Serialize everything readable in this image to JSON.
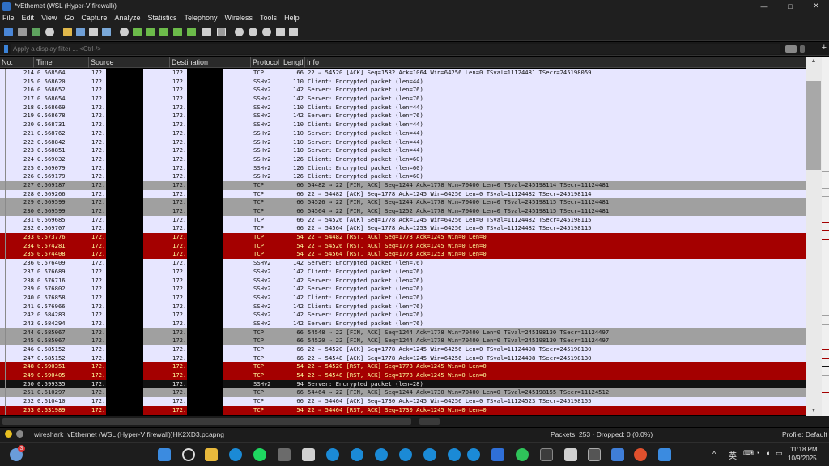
{
  "window": {
    "title": "*vEthernet (WSL (Hyper-V firewall))"
  },
  "menu": [
    "File",
    "Edit",
    "View",
    "Go",
    "Capture",
    "Analyze",
    "Statistics",
    "Telephony",
    "Wireless",
    "Tools",
    "Help"
  ],
  "filter": {
    "placeholder": "Apply a display filter ... <Ctrl-/>"
  },
  "columns": {
    "no": "No.",
    "time": "Time",
    "source": "Source",
    "destination": "Destination",
    "protocol": "Protocol",
    "length": "Lengtl",
    "info": "Info"
  },
  "packets": [
    {
      "no": "214",
      "time": "0.568564",
      "src": "172.",
      "dst": "172.",
      "proto": "TCP",
      "len": "66",
      "info": "22 → 54520 [ACK] Seq=1582 Ack=1064 Win=64256 Len=0 TSval=11124481 TSecr=245198059",
      "style": "tcp"
    },
    {
      "no": "215",
      "time": "0.568620",
      "src": "172.",
      "dst": "172.",
      "proto": "SSHv2",
      "len": "110",
      "info": "Client: Encrypted packet (len=44)",
      "style": "ssh"
    },
    {
      "no": "216",
      "time": "0.568652",
      "src": "172.",
      "dst": "172.",
      "proto": "SSHv2",
      "len": "142",
      "info": "Server: Encrypted packet (len=76)",
      "style": "ssh"
    },
    {
      "no": "217",
      "time": "0.568654",
      "src": "172.",
      "dst": "172.",
      "proto": "SSHv2",
      "len": "142",
      "info": "Server: Encrypted packet (len=76)",
      "style": "ssh"
    },
    {
      "no": "218",
      "time": "0.568669",
      "src": "172.",
      "dst": "172.",
      "proto": "SSHv2",
      "len": "110",
      "info": "Client: Encrypted packet (len=44)",
      "style": "ssh"
    },
    {
      "no": "219",
      "time": "0.568678",
      "src": "172.",
      "dst": "172.",
      "proto": "SSHv2",
      "len": "142",
      "info": "Server: Encrypted packet (len=76)",
      "style": "ssh"
    },
    {
      "no": "220",
      "time": "0.568731",
      "src": "172.",
      "dst": "172.",
      "proto": "SSHv2",
      "len": "110",
      "info": "Client: Encrypted packet (len=44)",
      "style": "ssh"
    },
    {
      "no": "221",
      "time": "0.568762",
      "src": "172.",
      "dst": "172.",
      "proto": "SSHv2",
      "len": "110",
      "info": "Server: Encrypted packet (len=44)",
      "style": "ssh"
    },
    {
      "no": "222",
      "time": "0.568842",
      "src": "172.",
      "dst": "172.",
      "proto": "SSHv2",
      "len": "110",
      "info": "Server: Encrypted packet (len=44)",
      "style": "ssh"
    },
    {
      "no": "223",
      "time": "0.568851",
      "src": "172.",
      "dst": "172.",
      "proto": "SSHv2",
      "len": "110",
      "info": "Server: Encrypted packet (len=44)",
      "style": "ssh"
    },
    {
      "no": "224",
      "time": "0.569032",
      "src": "172.",
      "dst": "172.",
      "proto": "SSHv2",
      "len": "126",
      "info": "Client: Encrypted packet (len=60)",
      "style": "ssh"
    },
    {
      "no": "225",
      "time": "0.569079",
      "src": "172.",
      "dst": "172.",
      "proto": "SSHv2",
      "len": "126",
      "info": "Client: Encrypted packet (len=60)",
      "style": "ssh"
    },
    {
      "no": "226",
      "time": "0.569179",
      "src": "172.",
      "dst": "172.",
      "proto": "SSHv2",
      "len": "126",
      "info": "Client: Encrypted packet (len=60)",
      "style": "ssh"
    },
    {
      "no": "227",
      "time": "0.569187",
      "src": "172.",
      "dst": "172.",
      "proto": "TCP",
      "len": "66",
      "info": "54482 → 22 [FIN, ACK] Seq=1244 Ack=1778 Win=70400 Len=0 TSval=245198114 TSecr=11124481",
      "style": "fin"
    },
    {
      "no": "228",
      "time": "0.569266",
      "src": "172.",
      "dst": "172.",
      "proto": "TCP",
      "len": "66",
      "info": "22 → 54482 [ACK] Seq=1778 Ack=1245 Win=64256 Len=0 TSval=11124482 TSecr=245198114",
      "style": "tcp"
    },
    {
      "no": "229",
      "time": "0.569599",
      "src": "172.",
      "dst": "172.",
      "proto": "TCP",
      "len": "66",
      "info": "54526 → 22 [FIN, ACK] Seq=1244 Ack=1778 Win=70400 Len=0 TSval=245198115 TSecr=11124481",
      "style": "fin"
    },
    {
      "no": "230",
      "time": "0.569599",
      "src": "172.",
      "dst": "172.",
      "proto": "TCP",
      "len": "66",
      "info": "54564 → 22 [FIN, ACK] Seq=1252 Ack=1778 Win=70400 Len=0 TSval=245198115 TSecr=11124481",
      "style": "fin"
    },
    {
      "no": "231",
      "time": "0.569685",
      "src": "172.",
      "dst": "172.",
      "proto": "TCP",
      "len": "66",
      "info": "22 → 54526 [ACK] Seq=1778 Ack=1245 Win=64256 Len=0 TSval=11124482 TSecr=245198115",
      "style": "tcp"
    },
    {
      "no": "232",
      "time": "0.569707",
      "src": "172.",
      "dst": "172.",
      "proto": "TCP",
      "len": "66",
      "info": "22 → 54564 [ACK] Seq=1778 Ack=1253 Win=64256 Len=0 TSval=11124482 TSecr=245198115",
      "style": "tcp"
    },
    {
      "no": "233",
      "time": "0.573776",
      "src": "172.",
      "dst": "172.",
      "proto": "TCP",
      "len": "54",
      "info": "22 → 54482 [RST, ACK] Seq=1778 Ack=1245 Win=0 Len=0",
      "style": "rst"
    },
    {
      "no": "234",
      "time": "0.574281",
      "src": "172.",
      "dst": "172.",
      "proto": "TCP",
      "len": "54",
      "info": "22 → 54526 [RST, ACK] Seq=1778 Ack=1245 Win=0 Len=0",
      "style": "rst"
    },
    {
      "no": "235",
      "time": "0.574408",
      "src": "172.",
      "dst": "172.",
      "proto": "TCP",
      "len": "54",
      "info": "22 → 54564 [RST, ACK] Seq=1778 Ack=1253 Win=0 Len=0",
      "style": "rst"
    },
    {
      "no": "236",
      "time": "0.576409",
      "src": "172.",
      "dst": "172.",
      "proto": "SSHv2",
      "len": "142",
      "info": "Server: Encrypted packet (len=76)",
      "style": "ssh"
    },
    {
      "no": "237",
      "time": "0.576689",
      "src": "172.",
      "dst": "172.",
      "proto": "SSHv2",
      "len": "142",
      "info": "Client: Encrypted packet (len=76)",
      "style": "ssh"
    },
    {
      "no": "238",
      "time": "0.576716",
      "src": "172.",
      "dst": "172.",
      "proto": "SSHv2",
      "len": "142",
      "info": "Server: Encrypted packet (len=76)",
      "style": "ssh"
    },
    {
      "no": "239",
      "time": "0.576802",
      "src": "172.",
      "dst": "172.",
      "proto": "SSHv2",
      "len": "142",
      "info": "Server: Encrypted packet (len=76)",
      "style": "ssh"
    },
    {
      "no": "240",
      "time": "0.576858",
      "src": "172.",
      "dst": "172.",
      "proto": "SSHv2",
      "len": "142",
      "info": "Client: Encrypted packet (len=76)",
      "style": "ssh"
    },
    {
      "no": "241",
      "time": "0.576966",
      "src": "172.",
      "dst": "172.",
      "proto": "SSHv2",
      "len": "142",
      "info": "Client: Encrypted packet (len=76)",
      "style": "ssh"
    },
    {
      "no": "242",
      "time": "0.584283",
      "src": "172.",
      "dst": "172.",
      "proto": "SSHv2",
      "len": "142",
      "info": "Server: Encrypted packet (len=76)",
      "style": "ssh"
    },
    {
      "no": "243",
      "time": "0.584294",
      "src": "172.",
      "dst": "172.",
      "proto": "SSHv2",
      "len": "142",
      "info": "Server: Encrypted packet (len=76)",
      "style": "ssh"
    },
    {
      "no": "244",
      "time": "0.585067",
      "src": "172.",
      "dst": "172.",
      "proto": "TCP",
      "len": "66",
      "info": "54548 → 22 [FIN, ACK] Seq=1244 Ack=1778 Win=70400 Len=0 TSval=245198130 TSecr=11124497",
      "style": "fin"
    },
    {
      "no": "245",
      "time": "0.585067",
      "src": "172.",
      "dst": "172.",
      "proto": "TCP",
      "len": "66",
      "info": "54520 → 22 [FIN, ACK] Seq=1244 Ack=1778 Win=70400 Len=0 TSval=245198130 TSecr=11124497",
      "style": "fin"
    },
    {
      "no": "246",
      "time": "0.585152",
      "src": "172.",
      "dst": "172.",
      "proto": "TCP",
      "len": "66",
      "info": "22 → 54520 [ACK] Seq=1778 Ack=1245 Win=64256 Len=0 TSval=11124498 TSecr=245198130",
      "style": "tcp"
    },
    {
      "no": "247",
      "time": "0.585152",
      "src": "172.",
      "dst": "172.",
      "proto": "TCP",
      "len": "66",
      "info": "22 → 54548 [ACK] Seq=1778 Ack=1245 Win=64256 Len=0 TSval=11124498 TSecr=245198130",
      "style": "tcp"
    },
    {
      "no": "248",
      "time": "0.590351",
      "src": "172.",
      "dst": "172.",
      "proto": "TCP",
      "len": "54",
      "info": "22 → 54520 [RST, ACK] Seq=1778 Ack=1245 Win=0 Len=0",
      "style": "rst"
    },
    {
      "no": "249",
      "time": "0.590405",
      "src": "172.",
      "dst": "172.",
      "proto": "TCP",
      "len": "54",
      "info": "22 → 54548 [RST, ACK] Seq=1778 Ack=1245 Win=0 Len=0",
      "style": "rst"
    },
    {
      "no": "250",
      "time": "0.599335",
      "src": "172.",
      "dst": "172.",
      "proto": "SSHv2",
      "len": "94",
      "info": "Server: Encrypted packet (len=28)",
      "style": "sel"
    },
    {
      "no": "251",
      "time": "0.610297",
      "src": "172.",
      "dst": "172.",
      "proto": "TCP",
      "len": "66",
      "info": "54464 → 22 [FIN, ACK] Seq=1244 Ack=1730 Win=70400 Len=0 TSval=245198155 TSecr=11124512",
      "style": "fin"
    },
    {
      "no": "252",
      "time": "0.610410",
      "src": "172.",
      "dst": "172.",
      "proto": "TCP",
      "len": "66",
      "info": "22 → 54464 [ACK] Seq=1730 Ack=1245 Win=64256 Len=0 TSval=11124523 TSecr=245198155",
      "style": "tcp"
    },
    {
      "no": "253",
      "time": "0.631989",
      "src": "172.",
      "dst": "172.",
      "proto": "TCP",
      "len": "54",
      "info": "22 → 54464 [RST, ACK] Seq=1730 Ack=1245 Win=0 Len=0",
      "style": "rst"
    }
  ],
  "status": {
    "file": "wireshark_vEthernet (WSL (Hyper-V firewall))HK2XD3.pcapng",
    "packets": "Packets: 253 · Dropped: 0 (0.0%)",
    "profile": "Profile: Default"
  },
  "taskbar": {
    "time": "11:18 PM",
    "date": "10/9/2025",
    "lang": "英",
    "weather_badge": "3"
  },
  "colors": {
    "rst_bg": "#a40000",
    "rst_fg": "#fffc9c",
    "fin_bg": "#a0a0a0",
    "normal_bg": "#e7e6ff",
    "selected_bg": "#121212"
  }
}
